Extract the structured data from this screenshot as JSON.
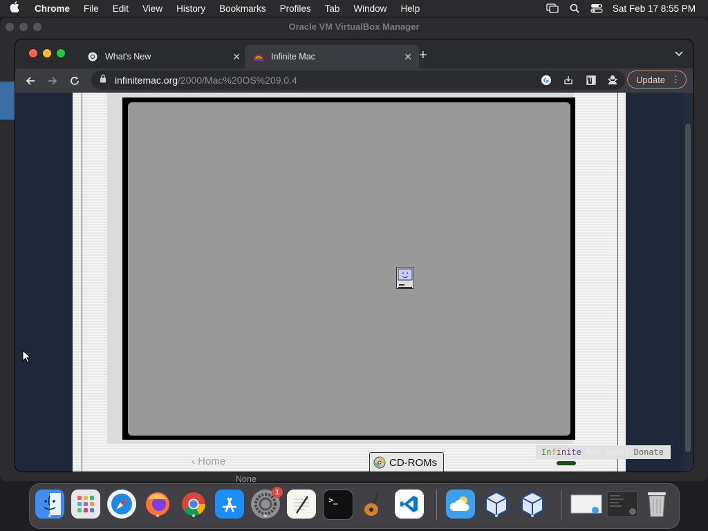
{
  "menubar": {
    "app_name": "Chrome",
    "items": [
      "File",
      "Edit",
      "View",
      "History",
      "Bookmarks",
      "Profiles",
      "Tab",
      "Window",
      "Help"
    ],
    "datetime": "Sat Feb 17  8:55 PM"
  },
  "background_window": {
    "title": "Oracle VM VirtualBox Manager"
  },
  "browser": {
    "tabs": [
      {
        "title": "What's New",
        "icon": "chrome-icon"
      },
      {
        "title": "Infinite Mac",
        "icon": "rainbow-icon"
      }
    ],
    "url_host": "infinitemac.org",
    "url_path": "/2000/Mac%20OS%209.0.4",
    "update_label": "Update"
  },
  "page": {
    "home_link": "‹ Home",
    "cdrom_label": "CD-ROMs",
    "footer": {
      "infinite_chars": [
        "In",
        "f",
        "i",
        "nite"
      ],
      "infinite_colors": [
        "#1aa31a",
        "#e2a800",
        "#d42020",
        "#7a2fb8"
      ],
      "mac_label": "Mac",
      "about_label": "About",
      "donate_label": "Donate"
    }
  },
  "status": {
    "text": "None"
  },
  "dock": {
    "apps": [
      "Finder",
      "Launchpad",
      "Safari",
      "Firefox",
      "Chrome",
      "App Store",
      "System Settings",
      "TextEdit",
      "Terminal",
      "GarageBand",
      "VS Code",
      "Weather",
      "VirtualBox",
      "VirtualBox VM",
      "Preview",
      "Screenshot",
      "Trash"
    ],
    "settings_badge": "1"
  }
}
